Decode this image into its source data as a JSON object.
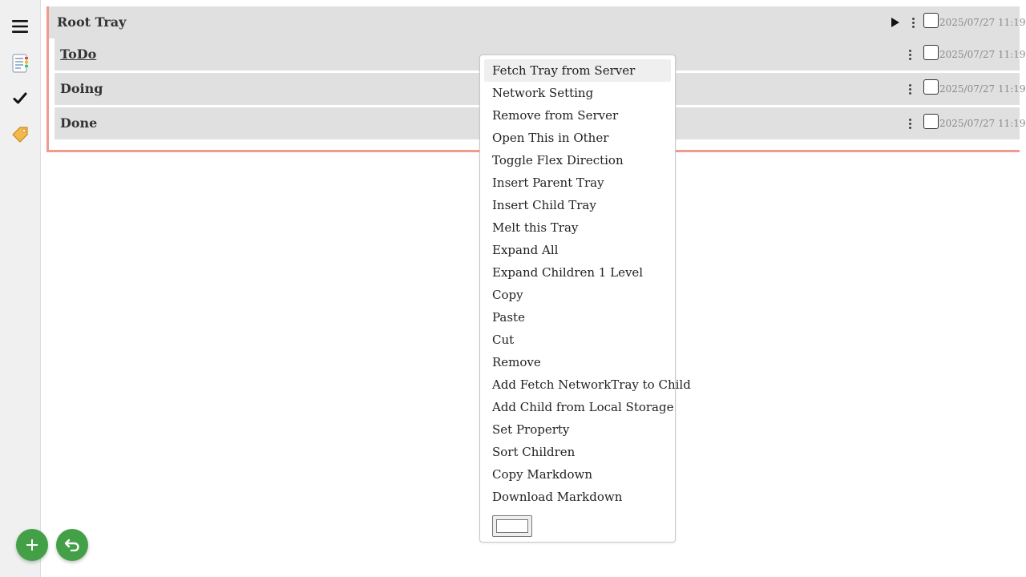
{
  "sidebar": {
    "items": [
      {
        "name": "menu",
        "icon": "hamburger-menu-icon"
      },
      {
        "name": "notes",
        "icon": "bookmark-tabs-icon"
      },
      {
        "name": "done",
        "icon": "check-mark-icon"
      },
      {
        "name": "tags",
        "icon": "label-tag-icon"
      }
    ]
  },
  "root": {
    "title": "Root Tray",
    "timestamp": "2025/07/27 11:19"
  },
  "children": [
    {
      "title": "ToDo",
      "timestamp": "2025/07/27 11:19"
    },
    {
      "title": "Doing",
      "timestamp": "2025/07/27 11:19"
    },
    {
      "title": "Done",
      "timestamp": "2025/07/27 11:19"
    }
  ],
  "menu": {
    "items": [
      "Fetch Tray from Server",
      "Network Setting",
      "Remove from Server",
      "Open This in Other",
      "Toggle Flex Direction",
      "Insert Parent Tray",
      "Insert Child Tray",
      "Melt this Tray",
      "Expand All",
      "Expand Children 1 Level",
      "Copy",
      "Paste",
      "Cut",
      "Remove",
      "Add Fetch NetworkTray to Child",
      "Add Child from Local Storage",
      "Set Property",
      "Sort Children",
      "Copy Markdown",
      "Download Markdown"
    ],
    "highlighted_index": 0,
    "color_value": "#ffffff"
  },
  "fabs": {
    "add_icon": "plus-icon",
    "back_icon": "return-arrow-icon"
  },
  "colors": {
    "accent_border": "#f19a8f",
    "row_background": "#e0e0e0",
    "fab_green": "#43a047",
    "sidebar_background": "#f0f0f0"
  }
}
